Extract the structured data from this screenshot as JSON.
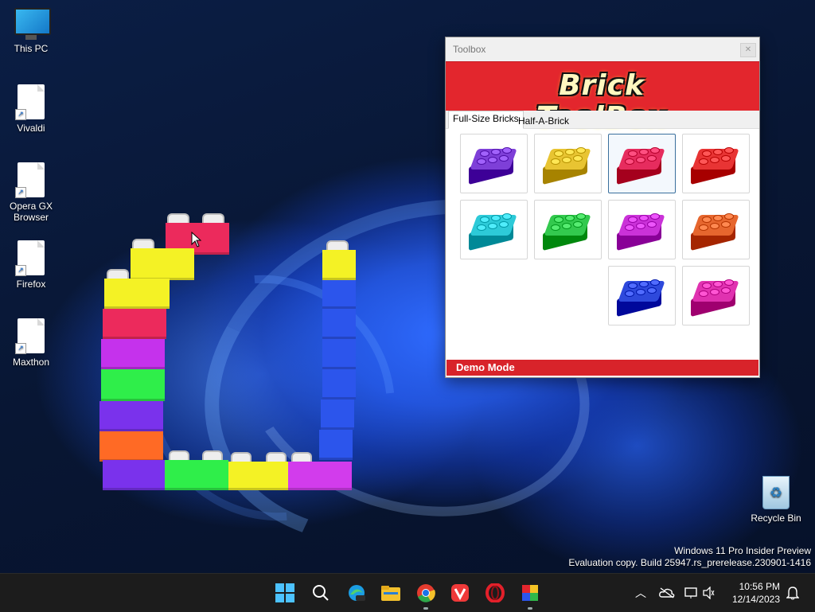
{
  "desktop_icons": [
    {
      "label": "This PC",
      "icon": "monitor-icon"
    },
    {
      "label": "Vivaldi",
      "icon": "file-shortcut-icon"
    },
    {
      "label": "Opera GX Browser",
      "icon": "file-shortcut-icon"
    },
    {
      "label": "Firefox",
      "icon": "file-shortcut-icon"
    },
    {
      "label": "Maxthon",
      "icon": "file-shortcut-icon"
    },
    {
      "label": "Recycle Bin",
      "icon": "recycle-bin-icon"
    }
  ],
  "toolbox": {
    "title": "Toolbox",
    "banner": "Brick ToolBox",
    "tabs": [
      "Full-Size Bricks",
      "Half-A-Brick"
    ],
    "active_tab": "Full-Size Bricks",
    "bricks": [
      {
        "color": "#6a2bc4",
        "selected": false
      },
      {
        "color": "#d4b01e",
        "selected": false
      },
      {
        "color": "#d2184a",
        "selected": true
      },
      {
        "color": "#d42020",
        "selected": false
      },
      {
        "color": "#19b6c4",
        "selected": false
      },
      {
        "color": "#1fb53a",
        "selected": false
      },
      {
        "color": "#b61ec4",
        "selected": false
      },
      {
        "color": "#d2521a",
        "selected": false
      },
      {
        "color": "#1a35c8",
        "selected": false
      },
      {
        "color": "#cc1e9c",
        "selected": false
      }
    ],
    "status": "Demo Mode"
  },
  "watermark": {
    "line1": "Windows 11 Pro Insider Preview",
    "line2": "Evaluation copy. Build 25947.rs_prerelease.230901-1416"
  },
  "taskbar": {
    "apps": [
      "start-icon",
      "search-icon",
      "edge-beta-icon",
      "file-explorer-icon",
      "chrome-icon",
      "vivaldi-icon",
      "opera-icon",
      "brick-toolbox-icon"
    ],
    "time": "10:56 PM",
    "date": "12/14/2023"
  }
}
